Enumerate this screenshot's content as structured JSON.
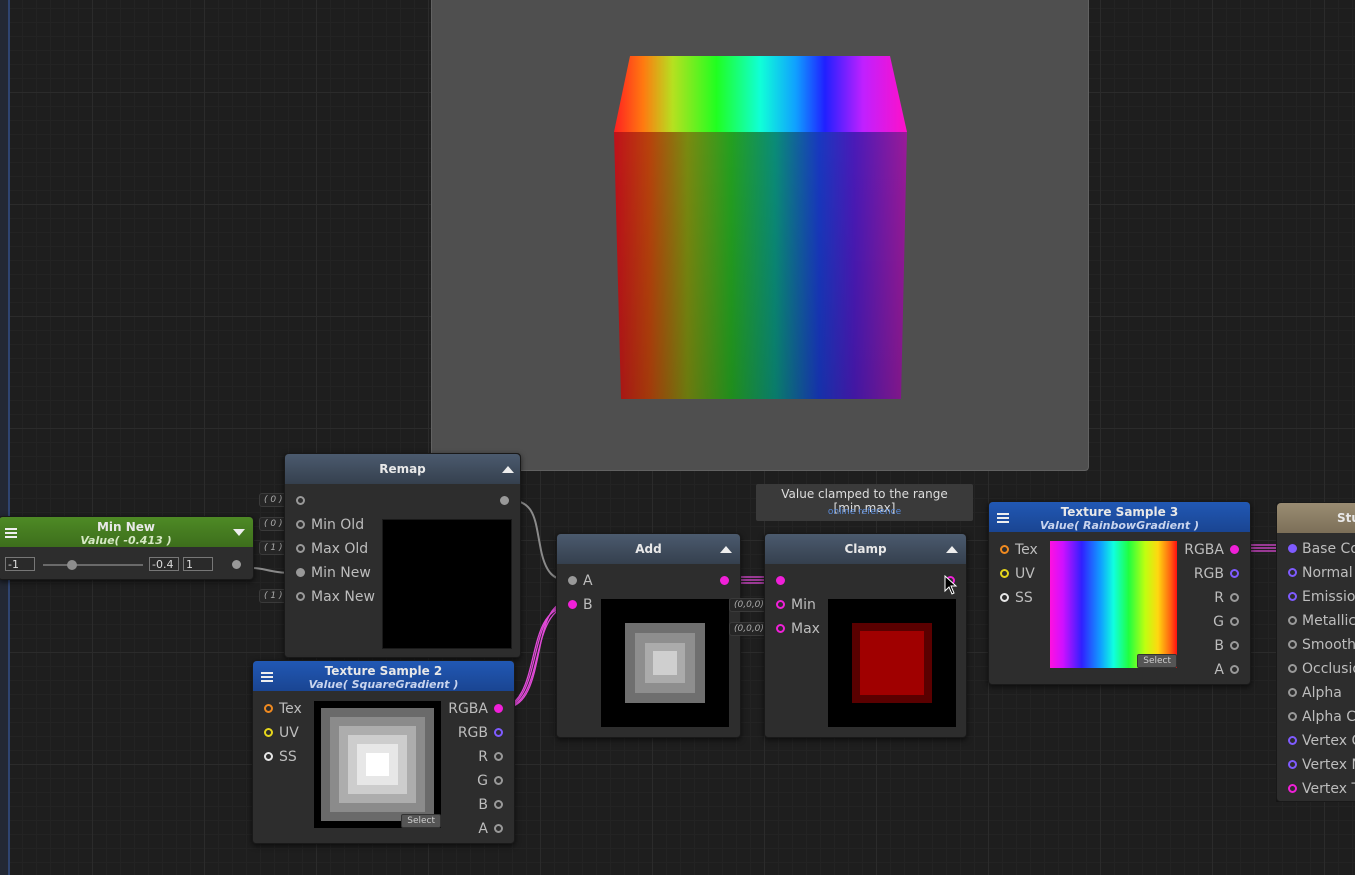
{
  "colors": {
    "magenta_wire": "#e24ad9",
    "port_orange": "#f08a20",
    "port_yellow": "#e6d61c",
    "port_white": "#e6e6e6",
    "port_purple": "#7f5bff",
    "port_magenta": "#f020d8",
    "port_gray": "#9a9a9a",
    "header_blue": "#1d4ea3",
    "header_green": "#4d8a22",
    "header_slate": "#3d4a5c"
  },
  "tooltip": {
    "text": "Value clamped to the range [min,max]",
    "link": "online reference"
  },
  "min_new_node": {
    "title": "Min New",
    "subtitle": "Value( -0.413 )",
    "slider_min": "-1",
    "slider_value": "-0.4",
    "slider_max": "1",
    "level": 0.29
  },
  "remap_node": {
    "title": "Remap",
    "inputs": [
      "",
      "Min Old",
      "Max Old",
      "Min New",
      "Max New"
    ],
    "defaults": [
      "( 0 )",
      "( 0 )",
      "( 1 )",
      "( 1 )"
    ]
  },
  "texture_sample_2": {
    "title": "Texture Sample 2",
    "subtitle": "Value( SquareGradient )",
    "inputs": [
      "Tex",
      "UV",
      "SS"
    ],
    "outputs": [
      "RGBA",
      "RGB",
      "R",
      "G",
      "B",
      "A"
    ],
    "select_label": "Select"
  },
  "add_node": {
    "title": "Add",
    "inputs": [
      "A",
      "B"
    ],
    "defaults": [
      "(0,0,0)",
      "(0,0,0)"
    ]
  },
  "clamp_node": {
    "title": "Clamp",
    "inputs": [
      "Min",
      "Max"
    ]
  },
  "texture_sample_3": {
    "title": "Texture Sample 3",
    "subtitle": "Value( RainbowGradient )",
    "inputs": [
      "Tex",
      "UV",
      "SS"
    ],
    "outputs": [
      "RGBA",
      "RGB",
      "R",
      "G",
      "B",
      "A"
    ],
    "select_label": "Select"
  },
  "output_node": {
    "title": "Stu",
    "inputs": [
      "Base Co",
      "Normal",
      "Emission",
      "Metallic",
      "Smoothr",
      "Occlusio",
      "Alpha",
      "Alpha Cl",
      "Vertex O",
      "Vertex N",
      "Vertex T"
    ]
  }
}
